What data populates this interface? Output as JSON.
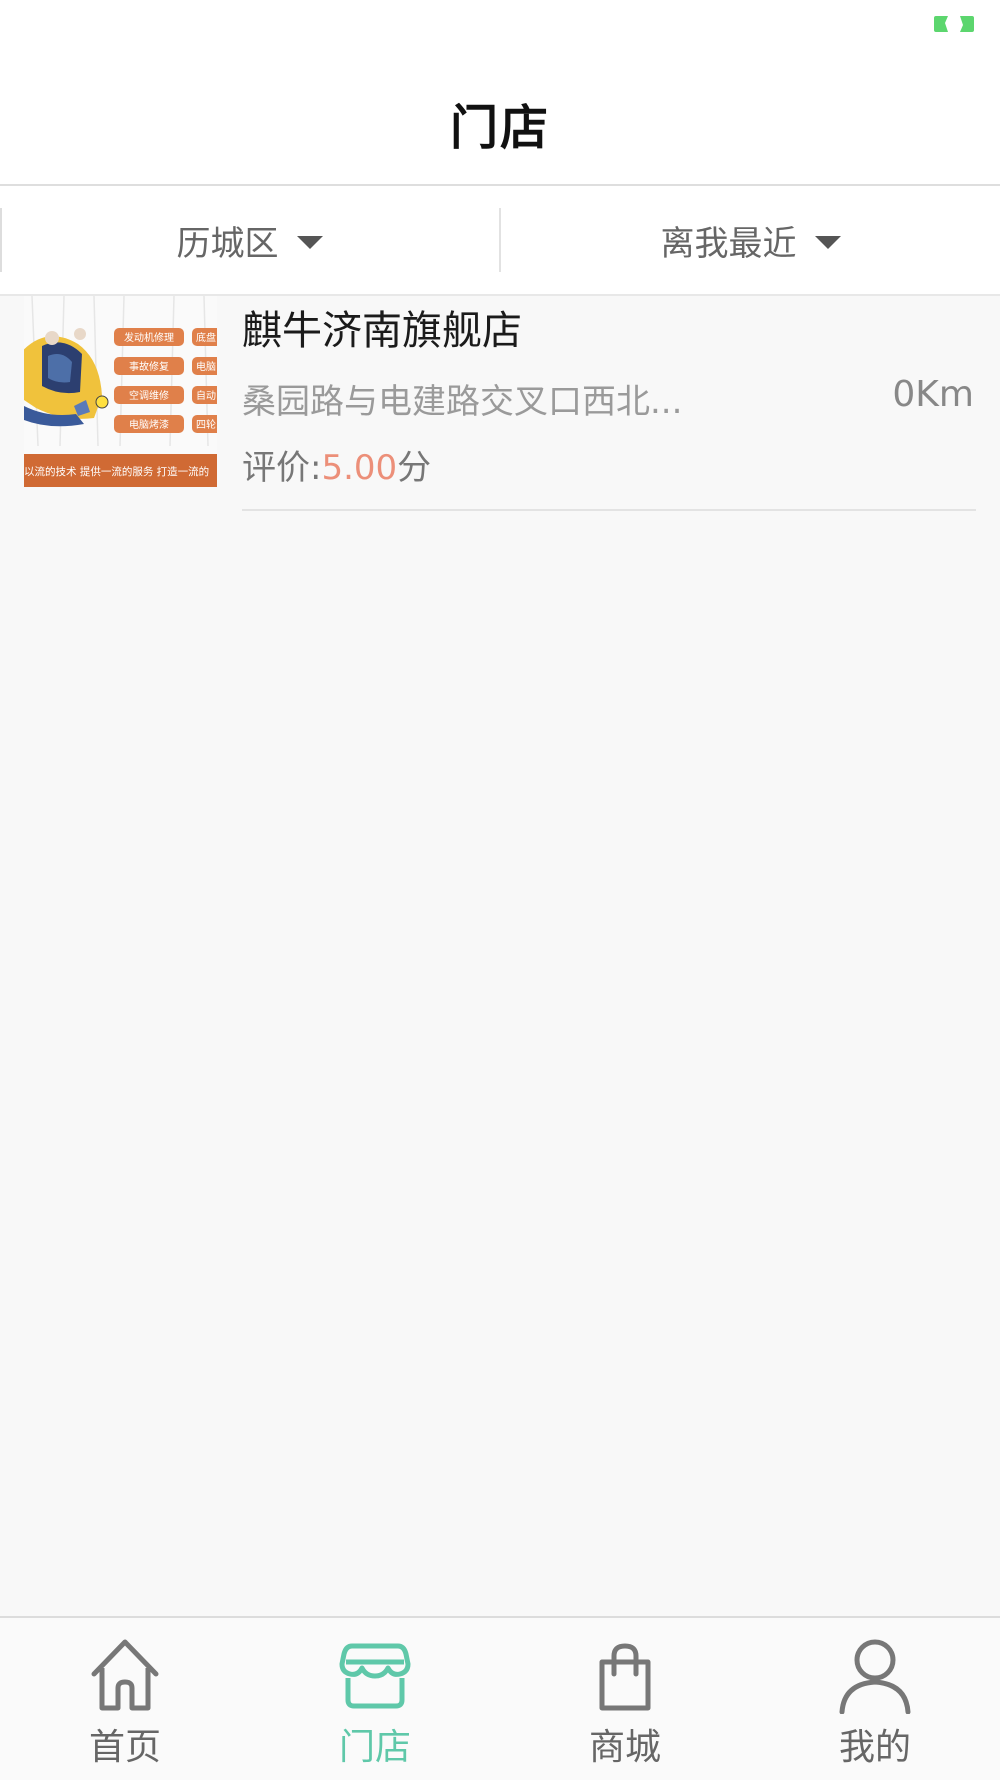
{
  "status_bar": {
    "indicator_icon": "battery-indicator-icon",
    "indicator_color": "#5cd66e"
  },
  "header": {
    "title": "门店"
  },
  "filters": {
    "district": {
      "label": "历城区",
      "icon": "caret-down-icon"
    },
    "sort": {
      "label": "离我最近",
      "icon": "caret-down-icon"
    }
  },
  "stores": [
    {
      "name": "麒牛济南旗舰店",
      "address": "桑园路与电建路交叉口西北...",
      "distance": "0Km",
      "rating_label": "评价:",
      "rating_value": "5.00",
      "rating_unit": "分",
      "thumbnail": {
        "services": [
          "发动机修理",
          "事故修复",
          "空调维修",
          "电脑烤漆"
        ],
        "services_partial": [
          "底盘",
          "电脑",
          "自动",
          "四轮"
        ],
        "slogan": "以流的技术 提供一流的服务 打造一流的"
      }
    }
  ],
  "tabbar": {
    "accent_color": "#5fc8a9",
    "items": [
      {
        "label": "首页",
        "icon": "home-icon",
        "active": false
      },
      {
        "label": "门店",
        "icon": "store-icon",
        "active": true
      },
      {
        "label": "商城",
        "icon": "shopping-bag-icon",
        "active": false
      },
      {
        "label": "我的",
        "icon": "user-icon",
        "active": false
      }
    ]
  }
}
